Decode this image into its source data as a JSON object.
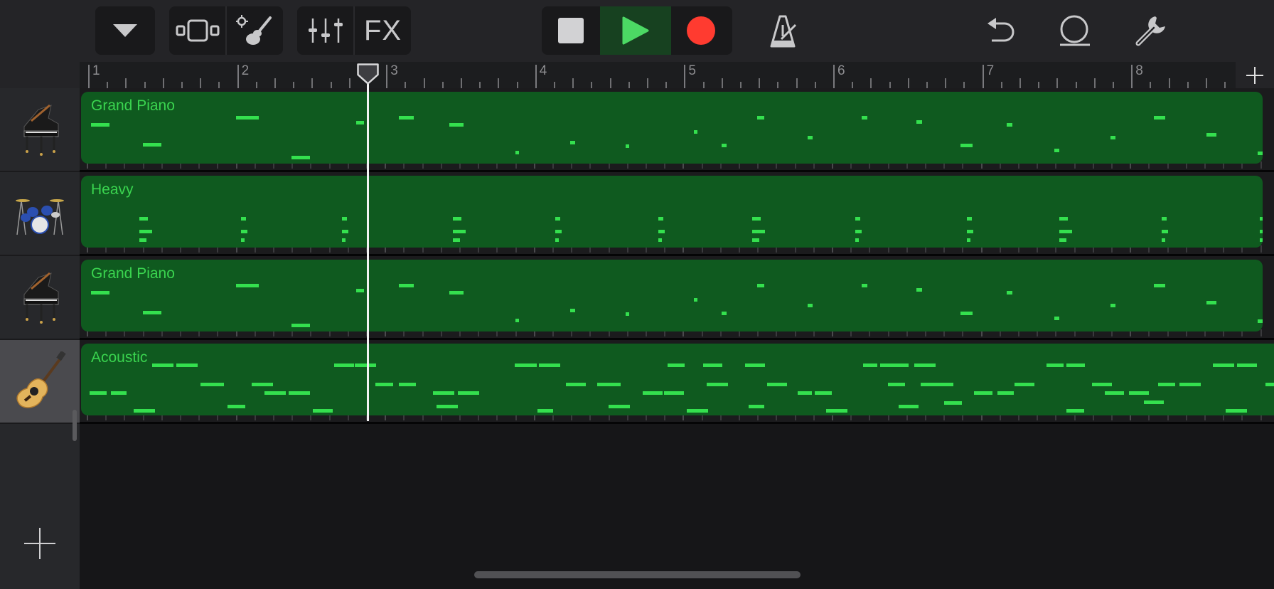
{
  "toolbar": {
    "dropdown_icon": "triangle-down-icon",
    "tracks_view_icon": "tracks-view-icon",
    "instrument_settings_icon": "guitar-gear-icon",
    "mixer_icon": "mixer-sliders-icon",
    "fx_label": "FX",
    "transport": {
      "stop_icon": "stop-square-icon",
      "play_icon": "play-triangle-icon",
      "record_icon": "record-circle-icon",
      "play_active": true
    },
    "metronome_icon": "metronome-icon",
    "undo_icon": "undo-arrow-icon",
    "loop_icon": "loop-browser-icon",
    "settings_icon": "wrench-icon"
  },
  "colors": {
    "accent_green": "#34e04e",
    "region_green": "#0f5a1f",
    "record_red": "#ff3b30",
    "play_green": "#4cd964"
  },
  "ruler": {
    "bars": [
      "1",
      "2",
      "3",
      "4",
      "5",
      "6",
      "7",
      "8"
    ],
    "add_section_icon": "plus-icon",
    "playhead_position_bars": 2.92
  },
  "tracks": [
    {
      "name": "Grand Piano",
      "instrument_icon": "grand-piano-icon",
      "selected": false
    },
    {
      "name": "Heavy",
      "instrument_icon": "drum-kit-icon",
      "selected": false
    },
    {
      "name": "Grand Piano",
      "instrument_icon": "grand-piano-icon",
      "selected": false
    },
    {
      "name": "Acoustic",
      "instrument_icon": "acoustic-guitar-icon",
      "selected": true
    }
  ],
  "add_track_icon": "plus-icon"
}
